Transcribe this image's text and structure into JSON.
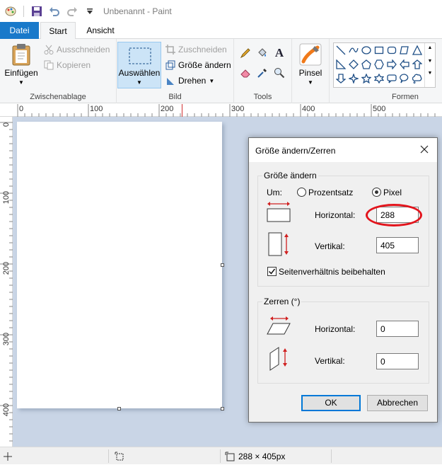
{
  "window": {
    "title": "Unbenannt - Paint"
  },
  "tabs": [
    {
      "label": "Datei"
    },
    {
      "label": "Start"
    },
    {
      "label": "Ansicht"
    }
  ],
  "ribbon": {
    "clipboard": {
      "paste_label": "Einfügen",
      "cut_label": "Ausschneiden",
      "copy_label": "Kopieren",
      "group_label": "Zwischenablage"
    },
    "image": {
      "select_label": "Auswählen",
      "crop_label": "Zuschneiden",
      "resize_label": "Größe ändern",
      "rotate_label": "Drehen",
      "group_label": "Bild"
    },
    "tools": {
      "group_label": "Tools"
    },
    "brushes": {
      "label": "Pinsel"
    },
    "shapes": {
      "group_label": "Formen"
    }
  },
  "ruler": {
    "top_labels": [
      "0",
      "100",
      "200",
      "300",
      "400",
      "500"
    ],
    "left_labels": [
      "0",
      "100",
      "200",
      "300",
      "400"
    ]
  },
  "statusbar": {
    "image_size": "288 × 405px"
  },
  "dialog": {
    "title": "Größe ändern/Zerren",
    "resize": {
      "legend": "Größe ändern",
      "by_label": "Um:",
      "option_percent": "Prozentsatz",
      "option_pixel": "Pixel",
      "selected": "Pixel",
      "horizontal_label": "Horizontal:",
      "horizontal_value": "288",
      "vertical_label": "Vertikal:",
      "vertical_value": "405",
      "keep_ratio_label": "Seitenverhältnis beibehalten",
      "keep_ratio_checked": true
    },
    "skew": {
      "legend": "Zerren (°)",
      "horizontal_label": "Horizontal:",
      "horizontal_value": "0",
      "vertical_label": "Vertikal:",
      "vertical_value": "0"
    },
    "ok_label": "OK",
    "cancel_label": "Abbrechen"
  },
  "colors": {
    "accent_blue": "#1979ca",
    "highlight": "#e3141c",
    "workspace": "#c9d5e6"
  }
}
